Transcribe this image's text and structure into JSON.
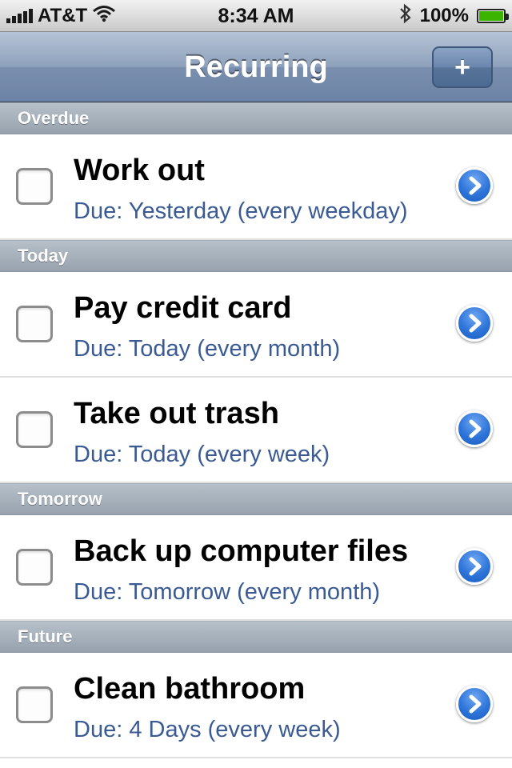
{
  "status_bar": {
    "carrier": "AT&T",
    "time": "8:34 AM",
    "battery": "100%",
    "battery_level": 1.0,
    "icons": [
      "signal-icon",
      "wifi-icon",
      "bluetooth-icon",
      "battery-icon"
    ]
  },
  "nav_bar": {
    "title": "Recurring",
    "add_label": "+"
  },
  "sections": {
    "overdue": {
      "title": "Overdue"
    },
    "today": {
      "title": "Today"
    },
    "tomorrow": {
      "title": "Tomorrow"
    },
    "future": {
      "title": "Future"
    }
  },
  "tasks": [
    {
      "title": "Work out",
      "due": "Due: Yesterday (every weekday)",
      "checked": false
    },
    {
      "title": "Pay credit card",
      "due": "Due: Today (every month)",
      "checked": false
    },
    {
      "title": "Take out trash",
      "due": "Due: Today (every week)",
      "checked": false
    },
    {
      "title": "Back up computer files",
      "due": "Due: Tomorrow (every month)",
      "checked": false
    },
    {
      "title": "Clean bathroom",
      "due": "Due: 4 Days (every week)",
      "checked": false
    }
  ],
  "colors": {
    "nav_bar": "#7d91b0",
    "section_header": "#a3adb8",
    "subtitle_text": "#3a5a94",
    "disclosure": "#2d74d9"
  }
}
